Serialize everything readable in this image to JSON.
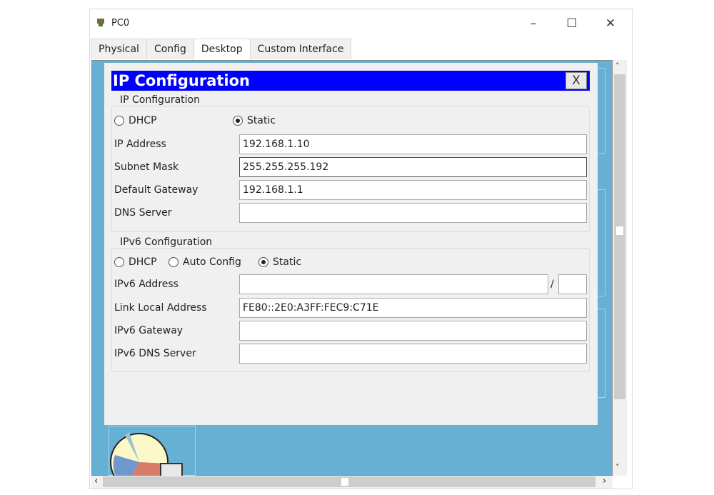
{
  "window": {
    "title": "PC0",
    "minimize": "–",
    "maximize": "☐",
    "close": "✕"
  },
  "tabs": [
    {
      "label": "Physical"
    },
    {
      "label": "Config"
    },
    {
      "label": "Desktop",
      "active": true
    },
    {
      "label": "Custom Interface"
    }
  ],
  "dialog": {
    "title": "IP Configuration",
    "close_label": "X",
    "ipv4": {
      "legend": "IP Configuration",
      "dhcp": "DHCP",
      "static": "Static",
      "selected": "Static",
      "ip_label": "IP Address",
      "ip_value": "192.168.1.10",
      "mask_label": "Subnet Mask",
      "mask_value": "255.255.255.192",
      "gw_label": "Default Gateway",
      "gw_value": "192.168.1.1",
      "dns_label": "DNS Server",
      "dns_value": ""
    },
    "ipv6": {
      "legend": "IPv6 Configuration",
      "dhcp": "DHCP",
      "auto": "Auto Config",
      "static": "Static",
      "selected": "Static",
      "addr_label": "IPv6 Address",
      "addr_value": "",
      "slash": "/",
      "prefix_value": "",
      "link_label": "Link Local Address",
      "link_value": "FE80::2E0:A3FF:FEC9:C71E",
      "gw_label": "IPv6 Gateway",
      "gw_value": "",
      "dns_label": "IPv6 DNS Server",
      "dns_value": ""
    }
  },
  "colors": {
    "header": "#0000ff",
    "desktop": "#65b0d3"
  }
}
